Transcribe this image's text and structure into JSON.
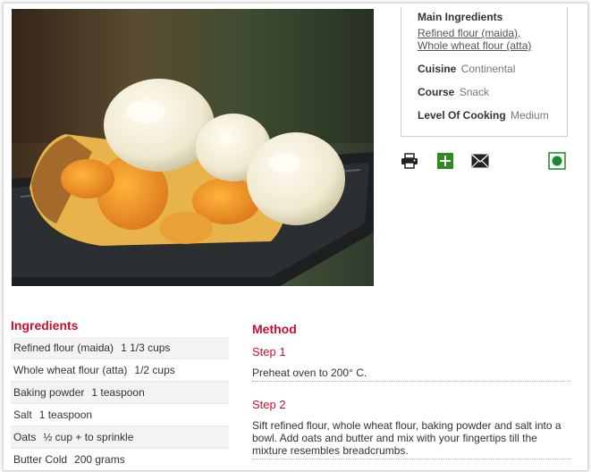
{
  "photo": {
    "alt": "Peach cobbler with vanilla ice cream"
  },
  "info": {
    "main_ingredients_label": "Main Ingredients",
    "main_ingredients": [
      "Refined flour (maida),",
      "Whole wheat flour (atta)"
    ],
    "cuisine_label": "Cuisine",
    "cuisine_value": "Continental",
    "course_label": "Course",
    "course_value": "Snack",
    "level_label": "Level Of Cooking",
    "level_value": "Medium"
  },
  "actions": {
    "icons": [
      "printer-icon",
      "add-icon",
      "email-icon",
      "veg-icon"
    ],
    "colors": {
      "add": "#2e8b1f",
      "veg": "#1a8a2a"
    }
  },
  "ingredients": {
    "heading": "Ingredients",
    "items": [
      {
        "name": "Refined flour (maida)",
        "qty": "1 1/3 cups"
      },
      {
        "name": "Whole wheat flour (atta)",
        "qty": "1/2 cups"
      },
      {
        "name": "Baking powder",
        "qty": "1 teaspoon"
      },
      {
        "name": "Salt",
        "qty": "1 teaspoon"
      },
      {
        "name": "Oats",
        "qty": "½ cup + to sprinkle"
      },
      {
        "name": "Butter Cold",
        "qty": "200 grams"
      }
    ]
  },
  "method": {
    "heading": "Method",
    "steps": [
      {
        "title": "Step 1",
        "text": "Preheat oven to 200° C."
      },
      {
        "title": "Step 2",
        "text": "Sift refined flour, whole wheat flour, baking powder and salt into a bowl. Add oats and butter and mix with your fingertips till the mixture resembles breadcrumbs."
      }
    ]
  },
  "colors": {
    "accent": "#c8102e"
  }
}
